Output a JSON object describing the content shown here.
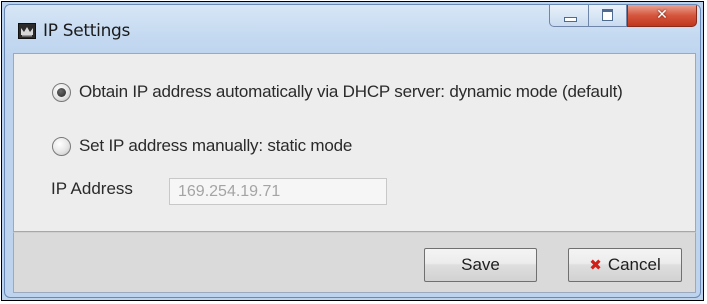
{
  "window": {
    "title": "IP Settings",
    "app_icon": "app-icon",
    "controls": {
      "minimize_icon": "minimize-icon",
      "maximize_icon": "maximize-icon",
      "close_glyph": "✕"
    }
  },
  "options": {
    "dhcp_label": "Obtain IP address automatically via DHCP server: dynamic mode (default)",
    "dhcp_selected": true,
    "static_label": "Set IP address manually: static mode",
    "static_selected": false
  },
  "ip_address": {
    "label": "IP Address",
    "value": "169.254.19.71",
    "disabled": true
  },
  "buttons": {
    "save_label": "Save",
    "cancel_label": "Cancel",
    "cancel_icon": "x-icon",
    "cancel_icon_color": "#d0201a"
  },
  "colors": {
    "frame": "#bcd3ee",
    "content_bg": "#ededed",
    "footer_bg": "#dadada",
    "close_button": "#c9432a"
  }
}
